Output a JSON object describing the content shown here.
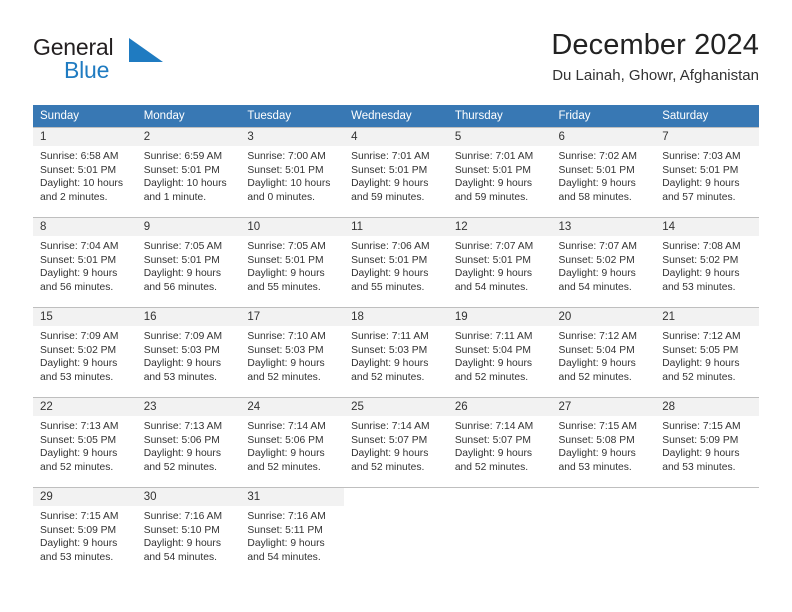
{
  "brand": {
    "name_part1": "General",
    "name_part2": "Blue",
    "triangle_color": "#1f7bc1",
    "text_color": "#231f20"
  },
  "header": {
    "title": "December 2024",
    "subtitle": "Du Lainah, Ghowr, Afghanistan"
  },
  "colors": {
    "header_row": "#3878b4",
    "daynum_bg": "#f2f2f2",
    "border": "#bfbfbf",
    "accent": "#1f7bc1"
  },
  "weekday_headers": [
    "Sunday",
    "Monday",
    "Tuesday",
    "Wednesday",
    "Thursday",
    "Friday",
    "Saturday"
  ],
  "weeks": [
    [
      {
        "day": "1",
        "sunrise": "Sunrise: 6:58 AM",
        "sunset": "Sunset: 5:01 PM",
        "daylight1": "Daylight: 10 hours",
        "daylight2": "and 2 minutes."
      },
      {
        "day": "2",
        "sunrise": "Sunrise: 6:59 AM",
        "sunset": "Sunset: 5:01 PM",
        "daylight1": "Daylight: 10 hours",
        "daylight2": "and 1 minute."
      },
      {
        "day": "3",
        "sunrise": "Sunrise: 7:00 AM",
        "sunset": "Sunset: 5:01 PM",
        "daylight1": "Daylight: 10 hours",
        "daylight2": "and 0 minutes."
      },
      {
        "day": "4",
        "sunrise": "Sunrise: 7:01 AM",
        "sunset": "Sunset: 5:01 PM",
        "daylight1": "Daylight: 9 hours",
        "daylight2": "and 59 minutes."
      },
      {
        "day": "5",
        "sunrise": "Sunrise: 7:01 AM",
        "sunset": "Sunset: 5:01 PM",
        "daylight1": "Daylight: 9 hours",
        "daylight2": "and 59 minutes."
      },
      {
        "day": "6",
        "sunrise": "Sunrise: 7:02 AM",
        "sunset": "Sunset: 5:01 PM",
        "daylight1": "Daylight: 9 hours",
        "daylight2": "and 58 minutes."
      },
      {
        "day": "7",
        "sunrise": "Sunrise: 7:03 AM",
        "sunset": "Sunset: 5:01 PM",
        "daylight1": "Daylight: 9 hours",
        "daylight2": "and 57 minutes."
      }
    ],
    [
      {
        "day": "8",
        "sunrise": "Sunrise: 7:04 AM",
        "sunset": "Sunset: 5:01 PM",
        "daylight1": "Daylight: 9 hours",
        "daylight2": "and 56 minutes."
      },
      {
        "day": "9",
        "sunrise": "Sunrise: 7:05 AM",
        "sunset": "Sunset: 5:01 PM",
        "daylight1": "Daylight: 9 hours",
        "daylight2": "and 56 minutes."
      },
      {
        "day": "10",
        "sunrise": "Sunrise: 7:05 AM",
        "sunset": "Sunset: 5:01 PM",
        "daylight1": "Daylight: 9 hours",
        "daylight2": "and 55 minutes."
      },
      {
        "day": "11",
        "sunrise": "Sunrise: 7:06 AM",
        "sunset": "Sunset: 5:01 PM",
        "daylight1": "Daylight: 9 hours",
        "daylight2": "and 55 minutes."
      },
      {
        "day": "12",
        "sunrise": "Sunrise: 7:07 AM",
        "sunset": "Sunset: 5:01 PM",
        "daylight1": "Daylight: 9 hours",
        "daylight2": "and 54 minutes."
      },
      {
        "day": "13",
        "sunrise": "Sunrise: 7:07 AM",
        "sunset": "Sunset: 5:02 PM",
        "daylight1": "Daylight: 9 hours",
        "daylight2": "and 54 minutes."
      },
      {
        "day": "14",
        "sunrise": "Sunrise: 7:08 AM",
        "sunset": "Sunset: 5:02 PM",
        "daylight1": "Daylight: 9 hours",
        "daylight2": "and 53 minutes."
      }
    ],
    [
      {
        "day": "15",
        "sunrise": "Sunrise: 7:09 AM",
        "sunset": "Sunset: 5:02 PM",
        "daylight1": "Daylight: 9 hours",
        "daylight2": "and 53 minutes."
      },
      {
        "day": "16",
        "sunrise": "Sunrise: 7:09 AM",
        "sunset": "Sunset: 5:03 PM",
        "daylight1": "Daylight: 9 hours",
        "daylight2": "and 53 minutes."
      },
      {
        "day": "17",
        "sunrise": "Sunrise: 7:10 AM",
        "sunset": "Sunset: 5:03 PM",
        "daylight1": "Daylight: 9 hours",
        "daylight2": "and 52 minutes."
      },
      {
        "day": "18",
        "sunrise": "Sunrise: 7:11 AM",
        "sunset": "Sunset: 5:03 PM",
        "daylight1": "Daylight: 9 hours",
        "daylight2": "and 52 minutes."
      },
      {
        "day": "19",
        "sunrise": "Sunrise: 7:11 AM",
        "sunset": "Sunset: 5:04 PM",
        "daylight1": "Daylight: 9 hours",
        "daylight2": "and 52 minutes."
      },
      {
        "day": "20",
        "sunrise": "Sunrise: 7:12 AM",
        "sunset": "Sunset: 5:04 PM",
        "daylight1": "Daylight: 9 hours",
        "daylight2": "and 52 minutes."
      },
      {
        "day": "21",
        "sunrise": "Sunrise: 7:12 AM",
        "sunset": "Sunset: 5:05 PM",
        "daylight1": "Daylight: 9 hours",
        "daylight2": "and 52 minutes."
      }
    ],
    [
      {
        "day": "22",
        "sunrise": "Sunrise: 7:13 AM",
        "sunset": "Sunset: 5:05 PM",
        "daylight1": "Daylight: 9 hours",
        "daylight2": "and 52 minutes."
      },
      {
        "day": "23",
        "sunrise": "Sunrise: 7:13 AM",
        "sunset": "Sunset: 5:06 PM",
        "daylight1": "Daylight: 9 hours",
        "daylight2": "and 52 minutes."
      },
      {
        "day": "24",
        "sunrise": "Sunrise: 7:14 AM",
        "sunset": "Sunset: 5:06 PM",
        "daylight1": "Daylight: 9 hours",
        "daylight2": "and 52 minutes."
      },
      {
        "day": "25",
        "sunrise": "Sunrise: 7:14 AM",
        "sunset": "Sunset: 5:07 PM",
        "daylight1": "Daylight: 9 hours",
        "daylight2": "and 52 minutes."
      },
      {
        "day": "26",
        "sunrise": "Sunrise: 7:14 AM",
        "sunset": "Sunset: 5:07 PM",
        "daylight1": "Daylight: 9 hours",
        "daylight2": "and 52 minutes."
      },
      {
        "day": "27",
        "sunrise": "Sunrise: 7:15 AM",
        "sunset": "Sunset: 5:08 PM",
        "daylight1": "Daylight: 9 hours",
        "daylight2": "and 53 minutes."
      },
      {
        "day": "28",
        "sunrise": "Sunrise: 7:15 AM",
        "sunset": "Sunset: 5:09 PM",
        "daylight1": "Daylight: 9 hours",
        "daylight2": "and 53 minutes."
      }
    ],
    [
      {
        "day": "29",
        "sunrise": "Sunrise: 7:15 AM",
        "sunset": "Sunset: 5:09 PM",
        "daylight1": "Daylight: 9 hours",
        "daylight2": "and 53 minutes."
      },
      {
        "day": "30",
        "sunrise": "Sunrise: 7:16 AM",
        "sunset": "Sunset: 5:10 PM",
        "daylight1": "Daylight: 9 hours",
        "daylight2": "and 54 minutes."
      },
      {
        "day": "31",
        "sunrise": "Sunrise: 7:16 AM",
        "sunset": "Sunset: 5:11 PM",
        "daylight1": "Daylight: 9 hours",
        "daylight2": "and 54 minutes."
      },
      {
        "day": "",
        "sunrise": "",
        "sunset": "",
        "daylight1": "",
        "daylight2": ""
      },
      {
        "day": "",
        "sunrise": "",
        "sunset": "",
        "daylight1": "",
        "daylight2": ""
      },
      {
        "day": "",
        "sunrise": "",
        "sunset": "",
        "daylight1": "",
        "daylight2": ""
      },
      {
        "day": "",
        "sunrise": "",
        "sunset": "",
        "daylight1": "",
        "daylight2": ""
      }
    ]
  ]
}
